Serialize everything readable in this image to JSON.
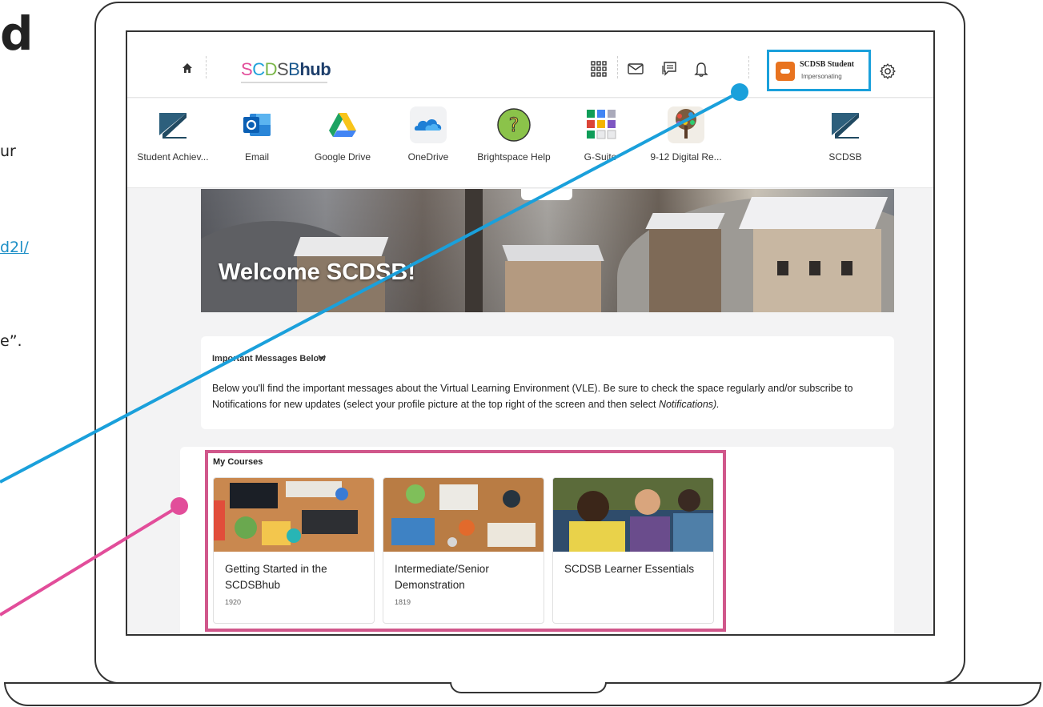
{
  "slide_fragments": {
    "big_letter": "d",
    "line1": "ur",
    "link": "d2l/",
    "line3": "e”."
  },
  "topbar": {
    "logo": {
      "s1": "S",
      "c1": "C",
      "d1": "D",
      "s2": "S",
      "b1": "B",
      "hub": "hub"
    },
    "profile": {
      "name": "SCDSB Student",
      "status": "Impersonating"
    }
  },
  "apps": [
    {
      "label": "Student Achiev...",
      "icon": "scdsb-logo-icon"
    },
    {
      "label": "Email",
      "icon": "outlook-icon"
    },
    {
      "label": "Google Drive",
      "icon": "google-drive-icon"
    },
    {
      "label": "OneDrive",
      "icon": "onedrive-icon"
    },
    {
      "label": "Brightspace Help",
      "icon": "help-question-icon"
    },
    {
      "label": "G-Suite",
      "icon": "gsuite-icon"
    },
    {
      "label": "9-12 Digital Re...",
      "icon": "tree-icon"
    },
    {
      "label": "SCDSB",
      "icon": "scdsb-logo-icon"
    }
  ],
  "banner": {
    "title": "Welcome SCDSB!"
  },
  "messages": {
    "title": "Important Messages Below",
    "body_prefix": "Below you'll find the important messages about the Virtual Learning Environment (VLE). Be sure to check the space regularly and/or subscribe to Notifications for new updates (select your profile picture at the top right of the screen and then select ",
    "body_emph": "Notifications).",
    "body_suffix": ""
  },
  "courses": {
    "title": "My Courses",
    "items": [
      {
        "name": "Getting Started in the SCDSBhub",
        "code": "1920"
      },
      {
        "name": "Intermediate/Senior Demonstration",
        "code": "1819"
      },
      {
        "name": "SCDSB Learner Essentials",
        "code": ""
      }
    ]
  },
  "colors": {
    "profile_highlight": "#1aa0db",
    "courses_highlight": "#d0578b",
    "avatar": "#e8731f"
  }
}
